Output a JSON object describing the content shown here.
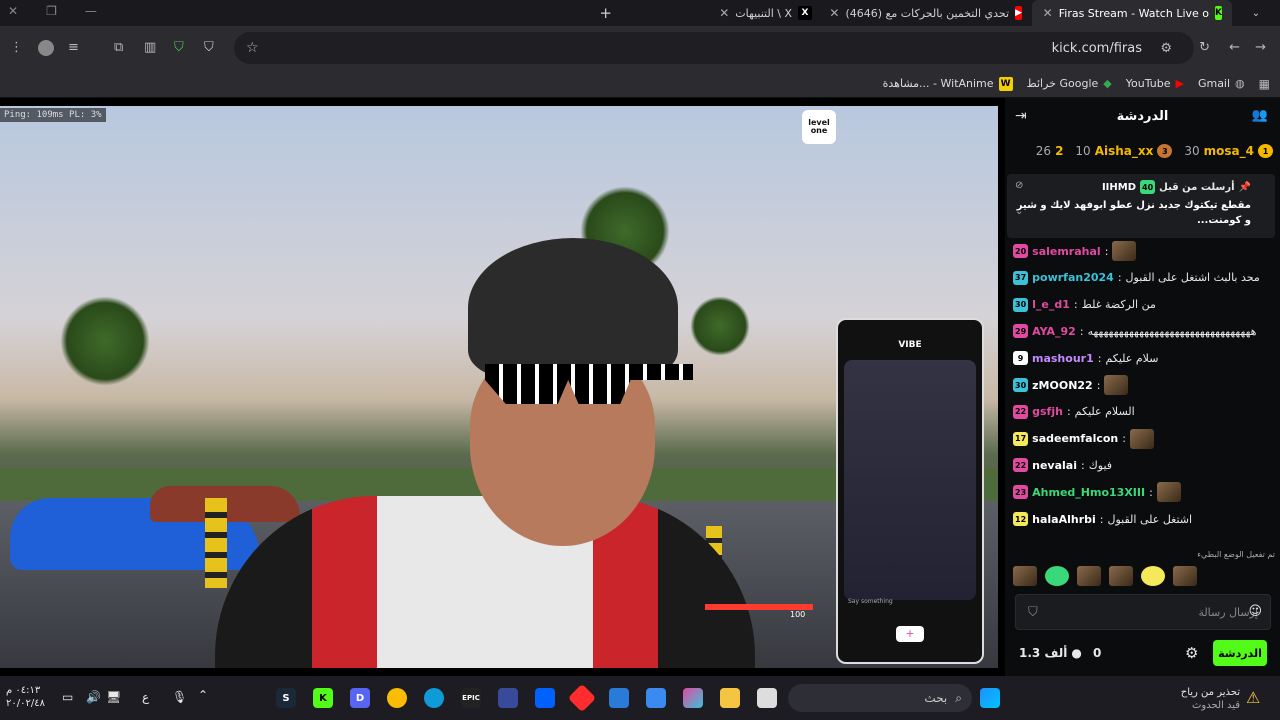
{
  "window": {
    "minimize": "—",
    "restore": "❐",
    "close": "✕"
  },
  "tabs": [
    {
      "title": "Firas Stream - Watch Live o",
      "icon": "kick-icon",
      "color": "#53fc18",
      "active": true
    },
    {
      "title": "(4646) تحدي التخمين بالحركات مع",
      "icon": "youtube-icon",
      "color": "#ff0000",
      "active": false
    },
    {
      "title": "التنبيهات \\ X",
      "icon": "x-icon",
      "color": "#ffffff",
      "active": false
    }
  ],
  "new_tab": "+",
  "address_bar": {
    "url": "kick.com/firas"
  },
  "bookmarks": [
    {
      "label": "Gmail",
      "icon": "google-icon"
    },
    {
      "label": "YouTube",
      "icon": "youtube-icon"
    },
    {
      "label": "خرائط Google",
      "icon": "maps-icon"
    },
    {
      "label": "مشاهدة... - WitAnime",
      "icon": "witanime-icon"
    }
  ],
  "video": {
    "overlay_stats": "Ping: 109ms   PL: 3%",
    "logo_text": "level one",
    "phone_app_title": "VIBE",
    "phone_input_placeholder": "Say something",
    "health_value": "100"
  },
  "chat": {
    "title": "الدردشة",
    "leaderboard": [
      {
        "rank": "1",
        "name": "mosa_4",
        "score": "30",
        "color": "#f5b800"
      },
      {
        "rank": "3",
        "name": "Aisha_xx",
        "score": "10",
        "color": "#c87533"
      },
      {
        "rank": "2",
        "name": "",
        "score": "26",
        "color": "#c0c0c0"
      }
    ],
    "pinned": {
      "author": "IIHMD",
      "time_label": "أرسلت من قبل",
      "badge": "40",
      "text": "مقطع تيكتوك جديد نزل عطو ابوفهد لايك و شير و كومنت..."
    },
    "messages": [
      {
        "badge": "20",
        "badge_color": "#e24aa1",
        "user": "salemrahal",
        "user_color": "#e24aa1",
        "text": "",
        "emote": true
      },
      {
        "badge": "37",
        "badge_color": "#3bc1d8",
        "user": "powrfan2024",
        "user_color": "#3bc1d8",
        "text": "محد بالبث اشتغل على القبول",
        "emote": false
      },
      {
        "badge": "30",
        "badge_color": "#3bc1d8",
        "user": "l_e_d1",
        "user_color": "#e24aa1",
        "text": "من الركضة غلط",
        "emote": false
      },
      {
        "badge": "29",
        "badge_color": "#e24aa1",
        "user": "AYA_92",
        "user_color": "#e24aa1",
        "text": "ههههههههههههههههههههههههههههههههه",
        "emote": false
      },
      {
        "badge": "9",
        "badge_color": "#ffffff",
        "user": "mashour1",
        "user_color": "#c28cff",
        "text": "سلام عليكم",
        "emote": false
      },
      {
        "badge": "30",
        "badge_color": "#3bc1d8",
        "user": "zMOON22",
        "user_color": "#ffffff",
        "text": "",
        "emote": true
      },
      {
        "badge": "22",
        "badge_color": "#e24aa1",
        "user": "gsfjh",
        "user_color": "#e24aa1",
        "text": "السلام عليكم",
        "emote": false
      },
      {
        "badge": "17",
        "badge_color": "#f5e85a",
        "user": "sadeemfalcon",
        "user_color": "#ffffff",
        "text": "",
        "emote": true
      },
      {
        "badge": "22",
        "badge_color": "#e24aa1",
        "user": "nevalai",
        "user_color": "#ffffff",
        "text": "فيوك",
        "emote": false
      },
      {
        "badge": "23",
        "badge_color": "#e24aa1",
        "user": "Ahmed_Hmo13XIII",
        "user_color": "#3bd87a",
        "text": "",
        "emote": true
      },
      {
        "badge": "12",
        "badge_color": "#f5e85a",
        "user": "halaAlhrbi",
        "user_color": "#ffffff",
        "text": "اشتغل على القبول",
        "emote": false
      }
    ],
    "emote_mode_notice": "تم تفعيل الوضع البطيء",
    "input_placeholder": "إرسال رسالة",
    "send_button": "الدردشة",
    "points": "0",
    "viewers": "1.3 ألف"
  },
  "taskbar": {
    "search_placeholder": "بحث",
    "clock_time": "٠٤:١٣ م",
    "clock_date": "٢٠/٠٢/٤٨",
    "lang": "ع",
    "notification_title": "تحذير من رياح",
    "notification_sub": "قيد الحدوث"
  }
}
